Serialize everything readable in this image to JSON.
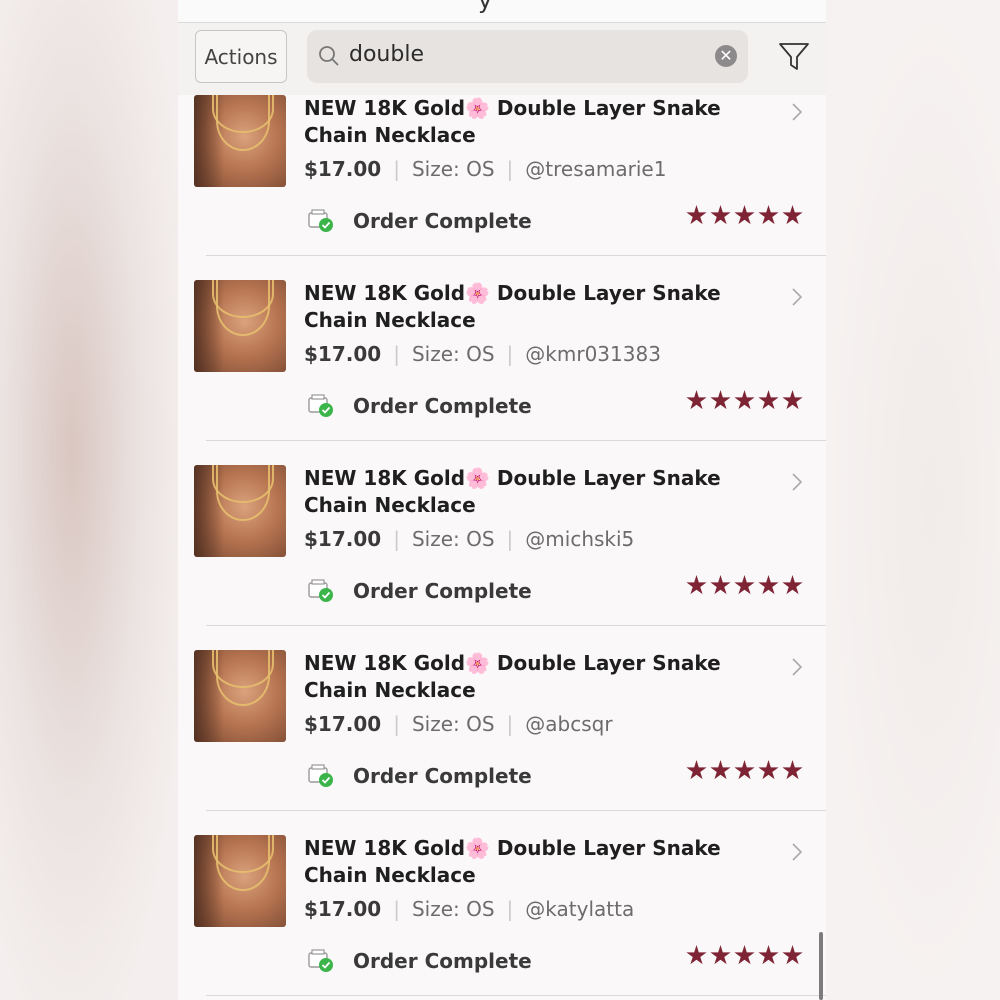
{
  "header": {
    "title_fragment": "y"
  },
  "toolbar": {
    "actions_label": "Actions",
    "search_value": "double",
    "clear_icon": "clear-icon",
    "filter_icon": "filter-icon"
  },
  "orders": [
    {
      "title": "NEW 18K Gold🌸 Double Layer Snake Chain Necklace",
      "price": "$17.00",
      "size": "Size: OS",
      "user": "@tresamarie1",
      "status": "Order Complete",
      "rating": 5
    },
    {
      "title": "NEW 18K Gold🌸 Double Layer Snake Chain Necklace",
      "price": "$17.00",
      "size": "Size: OS",
      "user": "@kmr031383",
      "status": "Order Complete",
      "rating": 5
    },
    {
      "title": "NEW 18K Gold🌸 Double Layer Snake Chain Necklace",
      "price": "$17.00",
      "size": "Size: OS",
      "user": "@michski5",
      "status": "Order Complete",
      "rating": 5
    },
    {
      "title": "NEW 18K Gold🌸 Double Layer Snake Chain Necklace",
      "price": "$17.00",
      "size": "Size: OS",
      "user": "@abcsqr",
      "status": "Order Complete",
      "rating": 5
    },
    {
      "title": "NEW 18K Gold🌸 Double Layer Snake Chain Necklace",
      "price": "$17.00",
      "size": "Size: OS",
      "user": "@katylatta",
      "status": "Order Complete",
      "rating": 5
    }
  ],
  "colors": {
    "star": "#7e2434",
    "status_check": "#3bb54a"
  }
}
